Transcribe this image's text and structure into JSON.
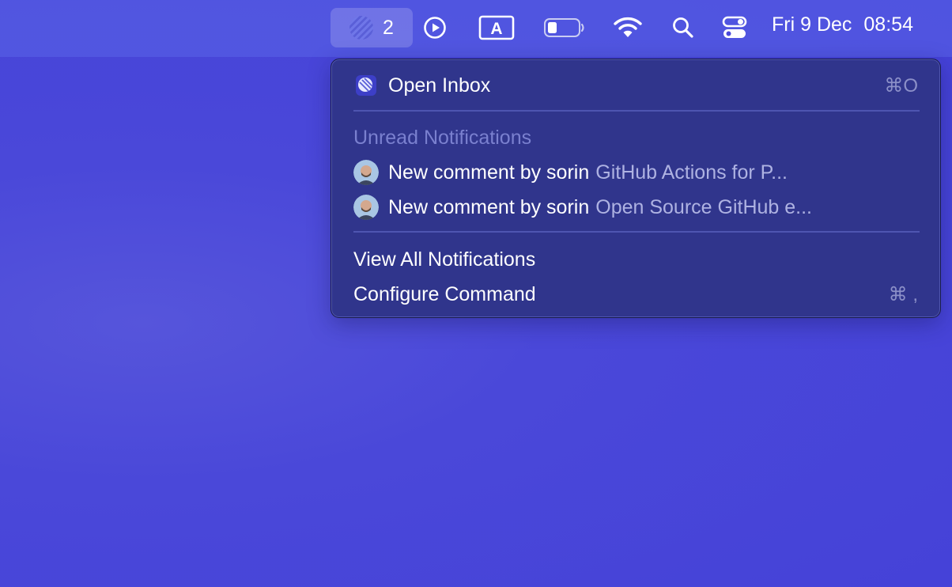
{
  "menubar": {
    "app_badge_count": "2",
    "date": "Fri 9 Dec",
    "time": "08:54",
    "status_icons": [
      "play-circle-icon",
      "input-source-a-icon",
      "battery-icon",
      "wifi-icon",
      "search-icon",
      "control-center-icon"
    ],
    "input_source_letter": "A"
  },
  "menu": {
    "open_inbox": {
      "label": "Open Inbox",
      "shortcut": "⌘O",
      "icon": "app-logo-icon"
    },
    "unread_header": "Unread Notifications",
    "notifications": [
      {
        "title": "New comment by sorin",
        "subtitle": "GitHub Actions for P...",
        "icon": "avatar"
      },
      {
        "title": "New comment by sorin",
        "subtitle": "Open Source GitHub e...",
        "icon": "avatar"
      }
    ],
    "view_all": "View All Notifications",
    "configure": {
      "label": "Configure Command",
      "shortcut": "⌘ ,"
    }
  },
  "colors": {
    "desktop": "#4a48d9",
    "menu_background": "#30358c",
    "muted_text": "#aeb2e2",
    "section_label": "#7a80cf"
  }
}
